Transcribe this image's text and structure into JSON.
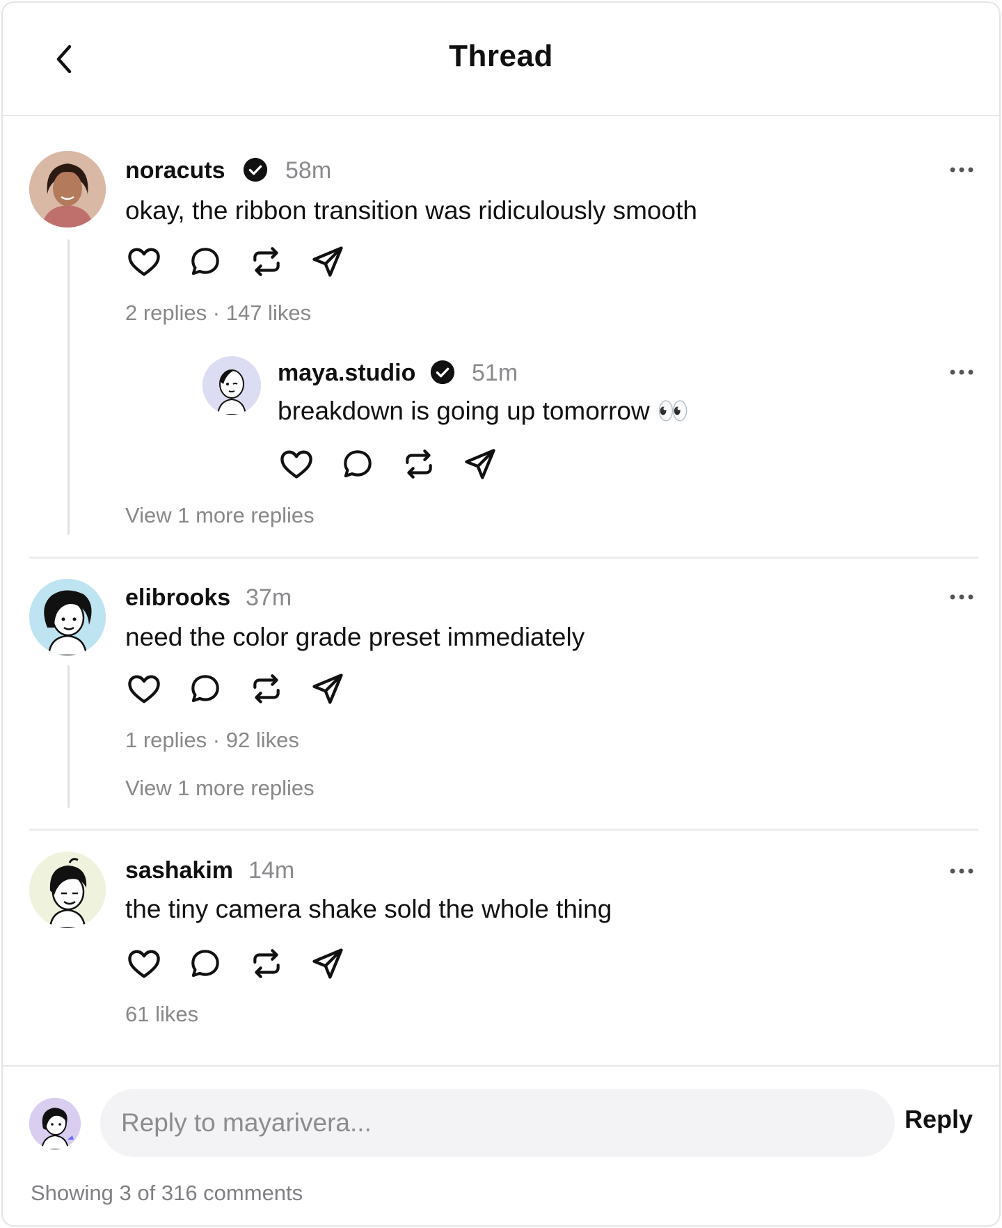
{
  "header": {
    "title": "Thread"
  },
  "comments": [
    {
      "username": "noracuts",
      "verified": true,
      "time": "58m",
      "text": "okay, the ribbon transition was ridiculously smooth",
      "meta": "2 replies · 147 likes",
      "reply": {
        "username": "maya.studio",
        "verified": true,
        "time": "51m",
        "text": "breakdown is going up tomorrow 👀"
      },
      "view_more": "View 1 more replies"
    },
    {
      "username": "elibrooks",
      "verified": false,
      "time": "37m",
      "text": "need the color grade preset immediately",
      "meta": "1 replies · 92 likes",
      "view_more": "View 1 more replies"
    },
    {
      "username": "sashakim",
      "verified": false,
      "time": "14m",
      "text": "the tiny camera shake sold the whole thing",
      "meta": "61 likes"
    }
  ],
  "composer": {
    "placeholder": "Reply to mayarivera...",
    "reply_label": "Reply"
  },
  "footer": {
    "status": "Showing 3 of 316 comments"
  },
  "icons": {
    "back": "chevron-left-icon",
    "verified": "verified-badge-icon",
    "like": "heart-icon",
    "comment": "comment-bubble-icon",
    "repost": "repost-icon",
    "share": "send-icon",
    "more": "more-horizontal-icon"
  },
  "colors": {
    "text": "#101010",
    "secondary": "#8a8a8e",
    "divider": "#ececef",
    "input_bg": "#f3f3f5"
  }
}
